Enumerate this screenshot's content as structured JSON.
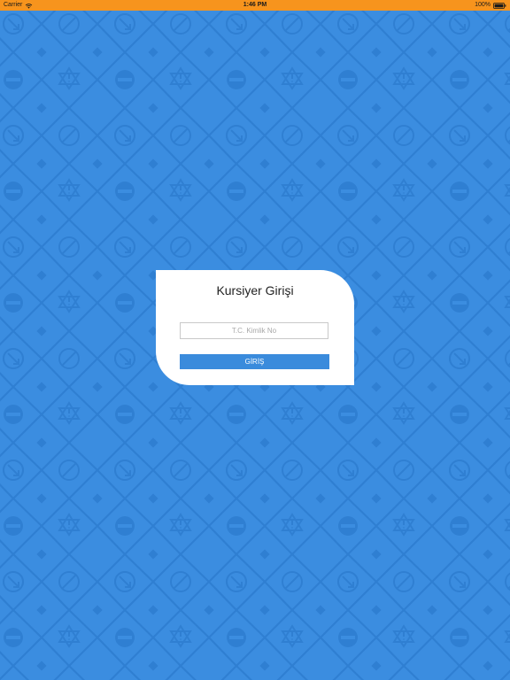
{
  "status_bar": {
    "carrier": "Carrier",
    "time": "1:46 PM",
    "battery": "100%",
    "wifi_icon": "wifi-icon",
    "battery_icon": "battery-icon"
  },
  "colors": {
    "status_bar_bg": "#f7941d",
    "background": "#3b8de0",
    "pattern": "#2f7fd2",
    "button": "#3a8bdc",
    "card": "#ffffff"
  },
  "background_pattern_icons": [
    "warning-sign-icon",
    "no-entry-sign-icon",
    "prohibited-sign-icon",
    "yield-sign-icon",
    "slope-sign-icon",
    "circle-sign-icon",
    "direction-arrow-sign-icon"
  ],
  "login": {
    "title": "Kursiyer Girişi",
    "tc_field": {
      "placeholder": "T.C. Kimlik No",
      "value": ""
    },
    "submit_label": "GİRİŞ"
  }
}
